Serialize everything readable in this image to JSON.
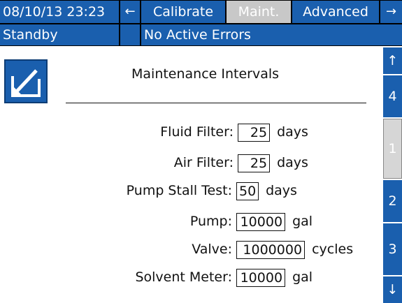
{
  "header": {
    "datetime": "08/10/13 23:23",
    "left_arrow": "←",
    "tabs": [
      {
        "label": "Calibrate"
      },
      {
        "label": "Maint."
      },
      {
        "label": "Advanced"
      }
    ],
    "right_arrow": "→"
  },
  "status": {
    "mode": "Standby",
    "errors": "No Active Errors"
  },
  "side_nav": {
    "up": "↑",
    "items": [
      "4",
      "1",
      "2",
      "3"
    ],
    "down": "↓"
  },
  "main": {
    "title": "Maintenance Intervals",
    "fields": [
      {
        "label": "Fluid Filter:",
        "value": "25",
        "unit": "days"
      },
      {
        "label": "Air Filter:",
        "value": "25",
        "unit": "days"
      },
      {
        "label": "Pump Stall Test:",
        "value": "50",
        "unit": "days"
      },
      {
        "label": "Pump:",
        "value": "10000",
        "unit": "gal"
      },
      {
        "label": "Valve:",
        "value": "1000000",
        "unit": "cycles"
      },
      {
        "label": "Solvent Meter:",
        "value": "10000",
        "unit": "gal"
      }
    ]
  },
  "colors": {
    "accent": "#1a5fae",
    "selected_tab": "#c8c8c8"
  }
}
